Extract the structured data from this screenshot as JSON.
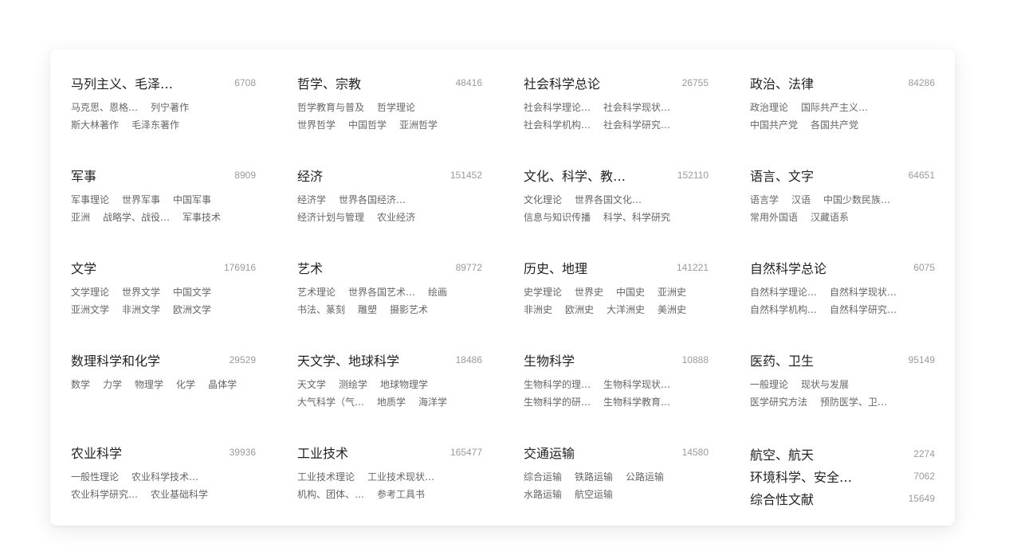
{
  "categories": [
    {
      "title": "马列主义、毛泽…",
      "count": "6708",
      "lines": [
        [
          "马克思、恩格…",
          "列宁著作"
        ],
        [
          "斯大林著作",
          "毛泽东著作"
        ]
      ]
    },
    {
      "title": "哲学、宗教",
      "count": "48416",
      "lines": [
        [
          "哲学教育与普及",
          "哲学理论"
        ],
        [
          "世界哲学",
          "中国哲学",
          "亚洲哲学"
        ]
      ]
    },
    {
      "title": "社会科学总论",
      "count": "26755",
      "lines": [
        [
          "社会科学理论…",
          "社会科学现状…"
        ],
        [
          "社会科学机构…",
          "社会科学研究…"
        ]
      ]
    },
    {
      "title": "政治、法律",
      "count": "84286",
      "lines": [
        [
          "政治理论",
          "国际共产主义…"
        ],
        [
          "中国共产党",
          "各国共产党"
        ]
      ]
    },
    {
      "title": "军事",
      "count": "8909",
      "lines": [
        [
          "军事理论",
          "世界军事",
          "中国军事"
        ],
        [
          "亚洲",
          "战略学、战役…",
          "军事技术"
        ]
      ]
    },
    {
      "title": "经济",
      "count": "151452",
      "lines": [
        [
          "经济学",
          "世界各国经济…"
        ],
        [
          "经济计划与管理",
          "农业经济"
        ]
      ]
    },
    {
      "title": "文化、科学、教…",
      "count": "152110",
      "lines": [
        [
          "文化理论",
          "世界各国文化…"
        ],
        [
          "信息与知识传播",
          "科学、科学研究"
        ]
      ]
    },
    {
      "title": "语言、文字",
      "count": "64651",
      "lines": [
        [
          "语言学",
          "汉语",
          "中国少数民族…"
        ],
        [
          "常用外国语",
          "汉藏语系"
        ]
      ]
    },
    {
      "title": "文学",
      "count": "176916",
      "lines": [
        [
          "文学理论",
          "世界文学",
          "中国文学"
        ],
        [
          "亚洲文学",
          "非洲文学",
          "欧洲文学"
        ]
      ]
    },
    {
      "title": "艺术",
      "count": "89772",
      "lines": [
        [
          "艺术理论",
          "世界各国艺术…",
          "绘画"
        ],
        [
          "书法、篆刻",
          "雕塑",
          "摄影艺术"
        ]
      ]
    },
    {
      "title": "历史、地理",
      "count": "141221",
      "lines": [
        [
          "史学理论",
          "世界史",
          "中国史",
          "亚洲史"
        ],
        [
          "非洲史",
          "欧洲史",
          "大洋洲史",
          "美洲史"
        ]
      ]
    },
    {
      "title": "自然科学总论",
      "count": "6075",
      "lines": [
        [
          "自然科学理论…",
          "自然科学现状…"
        ],
        [
          "自然科学机构…",
          "自然科学研究…"
        ]
      ]
    },
    {
      "title": "数理科学和化学",
      "count": "29529",
      "lines": [
        [
          "数学",
          "力学",
          "物理学",
          "化学",
          "晶体学"
        ]
      ]
    },
    {
      "title": "天文学、地球科学",
      "count": "18486",
      "lines": [
        [
          "天文学",
          "测绘学",
          "地球物理学"
        ],
        [
          "大气科学（气…",
          "地质学",
          "海洋学"
        ]
      ]
    },
    {
      "title": "生物科学",
      "count": "10888",
      "lines": [
        [
          "生物科学的理…",
          "生物科学现状…"
        ],
        [
          "生物科学的研…",
          "生物科学教育…"
        ]
      ]
    },
    {
      "title": "医药、卫生",
      "count": "95149",
      "lines": [
        [
          "一般理论",
          "现状与发展"
        ],
        [
          "医学研究方法",
          "预防医学、卫…"
        ]
      ]
    },
    {
      "title": "农业科学",
      "count": "39936",
      "lines": [
        [
          "一般性理论",
          "农业科学技术…"
        ],
        [
          "农业科学研究…",
          "农业基础科学"
        ]
      ]
    },
    {
      "title": "工业技术",
      "count": "165477",
      "lines": [
        [
          "工业技术理论",
          "工业技术现状…"
        ],
        [
          "机构、团体、…",
          "参考工具书"
        ]
      ]
    },
    {
      "title": "交通运输",
      "count": "14580",
      "lines": [
        [
          "综合运输",
          "铁路运输",
          "公路运输"
        ],
        [
          "水路运输",
          "航空运输"
        ]
      ]
    }
  ],
  "stacked": [
    {
      "title": "航空、航天",
      "count": "2274"
    },
    {
      "title": "环境科学、安全…",
      "count": "7062"
    },
    {
      "title": "综合性文献",
      "count": "15649"
    }
  ]
}
